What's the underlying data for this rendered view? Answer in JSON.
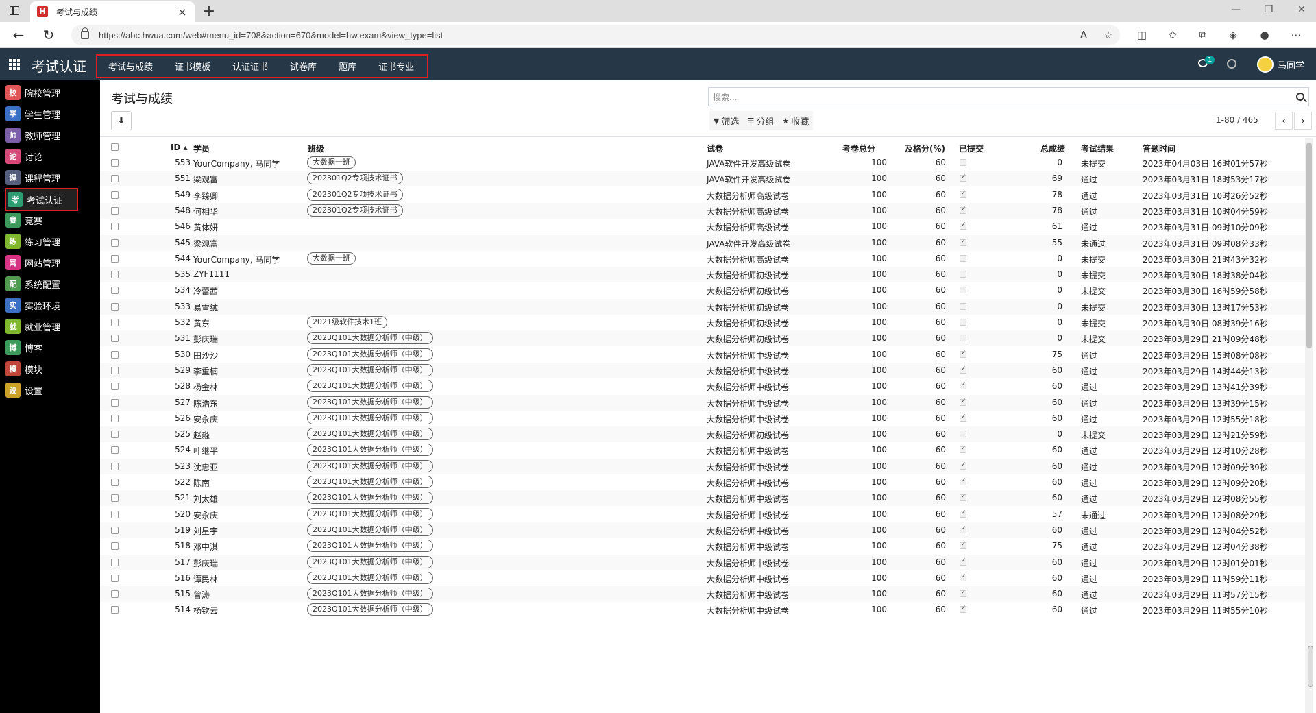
{
  "browser": {
    "tab_title": "考试与成绩",
    "favicon_letter": "H",
    "url": "https://abc.hwua.com/web#menu_id=708&action=670&model=hw.exam&view_type=list"
  },
  "app": {
    "name": "考试认证",
    "top_menu": [
      "考试与成绩",
      "证书模板",
      "认证证书",
      "试卷库",
      "题库",
      "证书专业"
    ],
    "message_badge": "1",
    "user_name": "马同学"
  },
  "sidebar": {
    "items": [
      {
        "label": "院校管理",
        "icon": "school-icon",
        "color": "#e05555",
        "glyph": "校"
      },
      {
        "label": "学生管理",
        "icon": "student-icon",
        "color": "#3b6fc4",
        "glyph": "学"
      },
      {
        "label": "教师管理",
        "icon": "teacher-icon",
        "color": "#7b5ea7",
        "glyph": "师"
      },
      {
        "label": "讨论",
        "icon": "chat-icon",
        "color": "#d64b7a",
        "glyph": "论"
      },
      {
        "label": "课程管理",
        "icon": "course-icon",
        "color": "#555e7d",
        "glyph": "课"
      },
      {
        "label": "考试认证",
        "icon": "exam-icon",
        "color": "#2e9e72",
        "glyph": "考"
      },
      {
        "label": "竞赛",
        "icon": "contest-icon",
        "color": "#3c9b5c",
        "glyph": "赛"
      },
      {
        "label": "练习管理",
        "icon": "practice-icon",
        "color": "#7fb82e",
        "glyph": "练"
      },
      {
        "label": "网站管理",
        "icon": "website-icon",
        "color": "#d63384",
        "glyph": "网"
      },
      {
        "label": "系统配置",
        "icon": "config-icon",
        "color": "#4f9a4f",
        "glyph": "配"
      },
      {
        "label": "实验环境",
        "icon": "lab-icon",
        "color": "#3b6fc4",
        "glyph": "实"
      },
      {
        "label": "就业管理",
        "icon": "job-icon",
        "color": "#7fb82e",
        "glyph": "就"
      },
      {
        "label": "博客",
        "icon": "blog-icon",
        "color": "#3c9b5c",
        "glyph": "博"
      },
      {
        "label": "模块",
        "icon": "module-icon",
        "color": "#c0453b",
        "glyph": "模"
      },
      {
        "label": "设置",
        "icon": "settings-icon",
        "color": "#c9a227",
        "glyph": "设"
      }
    ],
    "active_index": 5
  },
  "page": {
    "title": "考试与成绩",
    "search_placeholder": "搜索...",
    "filter_label": "筛选",
    "group_label": "分组",
    "favorite_label": "收藏",
    "pager": "1-80 / 465"
  },
  "table": {
    "columns": [
      "ID",
      "学员",
      "班级",
      "试卷",
      "考卷总分",
      "及格分(%)",
      "已提交",
      "总成绩",
      "考试结果",
      "答题时间"
    ],
    "rows": [
      {
        "id": "553",
        "student": "YourCompany, 马同学",
        "class": "大数据一班",
        "paper": "JAVA软件开发高级试卷",
        "total": "100",
        "pass": "60",
        "submitted": false,
        "score": "0",
        "result": "未提交",
        "time": "2023年04月03日 16时01分57秒"
      },
      {
        "id": "551",
        "student": "梁观富",
        "class": "202301Q2专项技术证书",
        "paper": "JAVA软件开发高级试卷",
        "total": "100",
        "pass": "60",
        "submitted": true,
        "score": "69",
        "result": "通过",
        "time": "2023年03月31日 18时53分17秒"
      },
      {
        "id": "549",
        "student": "李臻卿",
        "class": "202301Q2专项技术证书",
        "paper": "大数据分析师高级试卷",
        "total": "100",
        "pass": "60",
        "submitted": true,
        "score": "78",
        "result": "通过",
        "time": "2023年03月31日 10时26分52秒"
      },
      {
        "id": "548",
        "student": "何相华",
        "class": "202301Q2专项技术证书",
        "paper": "大数据分析师高级试卷",
        "total": "100",
        "pass": "60",
        "submitted": true,
        "score": "78",
        "result": "通过",
        "time": "2023年03月31日 10时04分59秒"
      },
      {
        "id": "546",
        "student": "黄体妍",
        "class": "",
        "paper": "大数据分析师高级试卷",
        "total": "100",
        "pass": "60",
        "submitted": true,
        "score": "61",
        "result": "通过",
        "time": "2023年03月31日 09时10分09秒"
      },
      {
        "id": "545",
        "student": "梁观富",
        "class": "",
        "paper": "JAVA软件开发高级试卷",
        "total": "100",
        "pass": "60",
        "submitted": true,
        "score": "55",
        "result": "未通过",
        "time": "2023年03月31日 09时08分33秒"
      },
      {
        "id": "544",
        "student": "YourCompany, 马同学",
        "class": "大数据一班",
        "paper": "大数据分析师高级试卷",
        "total": "100",
        "pass": "60",
        "submitted": false,
        "score": "0",
        "result": "未提交",
        "time": "2023年03月30日 21时43分32秒"
      },
      {
        "id": "535",
        "student": "ZYF1111",
        "class": "",
        "paper": "大数据分析师初级试卷",
        "total": "100",
        "pass": "60",
        "submitted": false,
        "score": "0",
        "result": "未提交",
        "time": "2023年03月30日 18时38分04秒"
      },
      {
        "id": "534",
        "student": "冷蕾茜",
        "class": "",
        "paper": "大数据分析师初级试卷",
        "total": "100",
        "pass": "60",
        "submitted": false,
        "score": "0",
        "result": "未提交",
        "time": "2023年03月30日 16时59分58秒"
      },
      {
        "id": "533",
        "student": "易雪绒",
        "class": "",
        "paper": "大数据分析师初级试卷",
        "total": "100",
        "pass": "60",
        "submitted": false,
        "score": "0",
        "result": "未提交",
        "time": "2023年03月30日 13时17分53秒"
      },
      {
        "id": "532",
        "student": "黄东",
        "class": "2021级软件技术1班",
        "paper": "大数据分析师初级试卷",
        "total": "100",
        "pass": "60",
        "submitted": false,
        "score": "0",
        "result": "未提交",
        "time": "2023年03月30日 08时39分16秒"
      },
      {
        "id": "531",
        "student": "彭庆瑞",
        "class": "2023Q101大数据分析师（中级）",
        "paper": "大数据分析师初级试卷",
        "total": "100",
        "pass": "60",
        "submitted": false,
        "score": "0",
        "result": "未提交",
        "time": "2023年03月29日 21时09分48秒"
      },
      {
        "id": "530",
        "student": "田沙沙",
        "class": "2023Q101大数据分析师（中级）",
        "paper": "大数据分析师中级试卷",
        "total": "100",
        "pass": "60",
        "submitted": true,
        "score": "75",
        "result": "通过",
        "time": "2023年03月29日 15时08分08秒"
      },
      {
        "id": "529",
        "student": "李重楠",
        "class": "2023Q101大数据分析师（中级）",
        "paper": "大数据分析师中级试卷",
        "total": "100",
        "pass": "60",
        "submitted": true,
        "score": "60",
        "result": "通过",
        "time": "2023年03月29日 14时44分13秒"
      },
      {
        "id": "528",
        "student": "杨金林",
        "class": "2023Q101大数据分析师（中级）",
        "paper": "大数据分析师中级试卷",
        "total": "100",
        "pass": "60",
        "submitted": true,
        "score": "60",
        "result": "通过",
        "time": "2023年03月29日 13时41分39秒"
      },
      {
        "id": "527",
        "student": "陈浩东",
        "class": "2023Q101大数据分析师（中级）",
        "paper": "大数据分析师中级试卷",
        "total": "100",
        "pass": "60",
        "submitted": true,
        "score": "60",
        "result": "通过",
        "time": "2023年03月29日 13时39分15秒"
      },
      {
        "id": "526",
        "student": "安永庆",
        "class": "2023Q101大数据分析师（中级）",
        "paper": "大数据分析师中级试卷",
        "total": "100",
        "pass": "60",
        "submitted": true,
        "score": "60",
        "result": "通过",
        "time": "2023年03月29日 12时55分18秒"
      },
      {
        "id": "525",
        "student": "赵淼",
        "class": "2023Q101大数据分析师（中级）",
        "paper": "大数据分析师初级试卷",
        "total": "100",
        "pass": "60",
        "submitted": false,
        "score": "0",
        "result": "未提交",
        "time": "2023年03月29日 12时21分59秒"
      },
      {
        "id": "524",
        "student": "叶继平",
        "class": "2023Q101大数据分析师（中级）",
        "paper": "大数据分析师中级试卷",
        "total": "100",
        "pass": "60",
        "submitted": true,
        "score": "60",
        "result": "通过",
        "time": "2023年03月29日 12时10分28秒"
      },
      {
        "id": "523",
        "student": "沈忠亚",
        "class": "2023Q101大数据分析师（中级）",
        "paper": "大数据分析师中级试卷",
        "total": "100",
        "pass": "60",
        "submitted": true,
        "score": "60",
        "result": "通过",
        "time": "2023年03月29日 12时09分39秒"
      },
      {
        "id": "522",
        "student": "陈南",
        "class": "2023Q101大数据分析师（中级）",
        "paper": "大数据分析师中级试卷",
        "total": "100",
        "pass": "60",
        "submitted": true,
        "score": "60",
        "result": "通过",
        "time": "2023年03月29日 12时09分20秒"
      },
      {
        "id": "521",
        "student": "刘太雄",
        "class": "2023Q101大数据分析师（中级）",
        "paper": "大数据分析师中级试卷",
        "total": "100",
        "pass": "60",
        "submitted": true,
        "score": "60",
        "result": "通过",
        "time": "2023年03月29日 12时08分55秒"
      },
      {
        "id": "520",
        "student": "安永庆",
        "class": "2023Q101大数据分析师（中级）",
        "paper": "大数据分析师中级试卷",
        "total": "100",
        "pass": "60",
        "submitted": true,
        "score": "57",
        "result": "未通过",
        "time": "2023年03月29日 12时08分29秒"
      },
      {
        "id": "519",
        "student": "刘星宇",
        "class": "2023Q101大数据分析师（中级）",
        "paper": "大数据分析师中级试卷",
        "total": "100",
        "pass": "60",
        "submitted": true,
        "score": "60",
        "result": "通过",
        "time": "2023年03月29日 12时04分52秒"
      },
      {
        "id": "518",
        "student": "邓中淇",
        "class": "2023Q101大数据分析师（中级）",
        "paper": "大数据分析师中级试卷",
        "total": "100",
        "pass": "60",
        "submitted": true,
        "score": "75",
        "result": "通过",
        "time": "2023年03月29日 12时04分38秒"
      },
      {
        "id": "517",
        "student": "彭庆瑞",
        "class": "2023Q101大数据分析师（中级）",
        "paper": "大数据分析师中级试卷",
        "total": "100",
        "pass": "60",
        "submitted": true,
        "score": "60",
        "result": "通过",
        "time": "2023年03月29日 12时01分01秒"
      },
      {
        "id": "516",
        "student": "谭民林",
        "class": "2023Q101大数据分析师（中级）",
        "paper": "大数据分析师中级试卷",
        "total": "100",
        "pass": "60",
        "submitted": true,
        "score": "60",
        "result": "通过",
        "time": "2023年03月29日 11时59分11秒"
      },
      {
        "id": "515",
        "student": "曾涛",
        "class": "2023Q101大数据分析师（中级）",
        "paper": "大数据分析师中级试卷",
        "total": "100",
        "pass": "60",
        "submitted": true,
        "score": "60",
        "result": "通过",
        "time": "2023年03月29日 11时57分15秒"
      },
      {
        "id": "514",
        "student": "杨钦云",
        "class": "2023Q101大数据分析师（中级）",
        "paper": "大数据分析师中级试卷",
        "total": "100",
        "pass": "60",
        "submitted": true,
        "score": "60",
        "result": "通过",
        "time": "2023年03月29日 11时55分10秒"
      }
    ]
  }
}
